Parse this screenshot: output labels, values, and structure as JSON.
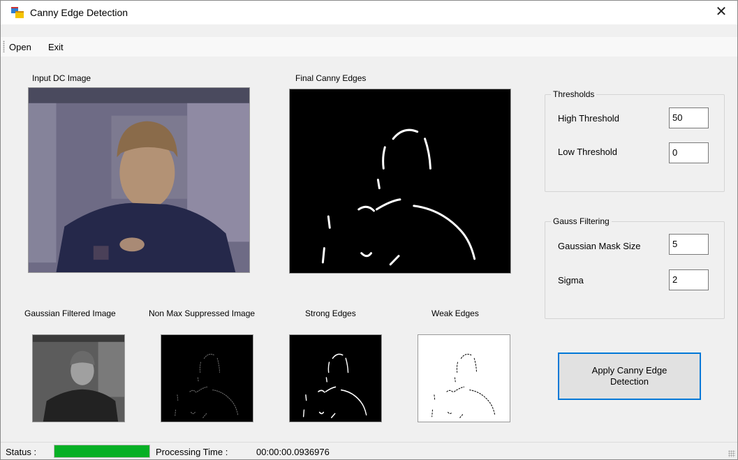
{
  "window": {
    "title": "Canny Edge Detection",
    "close_glyph": "✕",
    "icon": "app-window-icon"
  },
  "menu": {
    "items": [
      "Open",
      "Exit"
    ]
  },
  "panels": {
    "input": "Input DC Image",
    "final": "Final Canny Edges",
    "gaussian": "Gaussian Filtered Image",
    "nonmax": "Non Max Suppressed Image",
    "strong": "Strong Edges",
    "weak": "Weak Edges"
  },
  "thresholds": {
    "legend": "Thresholds",
    "high_label": "High Threshold",
    "high_value": "50",
    "low_label": "Low Threshold",
    "low_value": "0"
  },
  "gauss": {
    "legend": "Gauss Filtering",
    "mask_label": "Gaussian Mask Size",
    "mask_value": "5",
    "sigma_label": "Sigma",
    "sigma_value": "2"
  },
  "apply_button": "Apply Canny Edge Detection",
  "status": {
    "label": "Status :",
    "progress": 1.0,
    "time_label": "Processing Time :",
    "time_value": "00:00:00.0936976"
  },
  "colors": {
    "progress": "#06b025",
    "accent": "#0078d7"
  }
}
